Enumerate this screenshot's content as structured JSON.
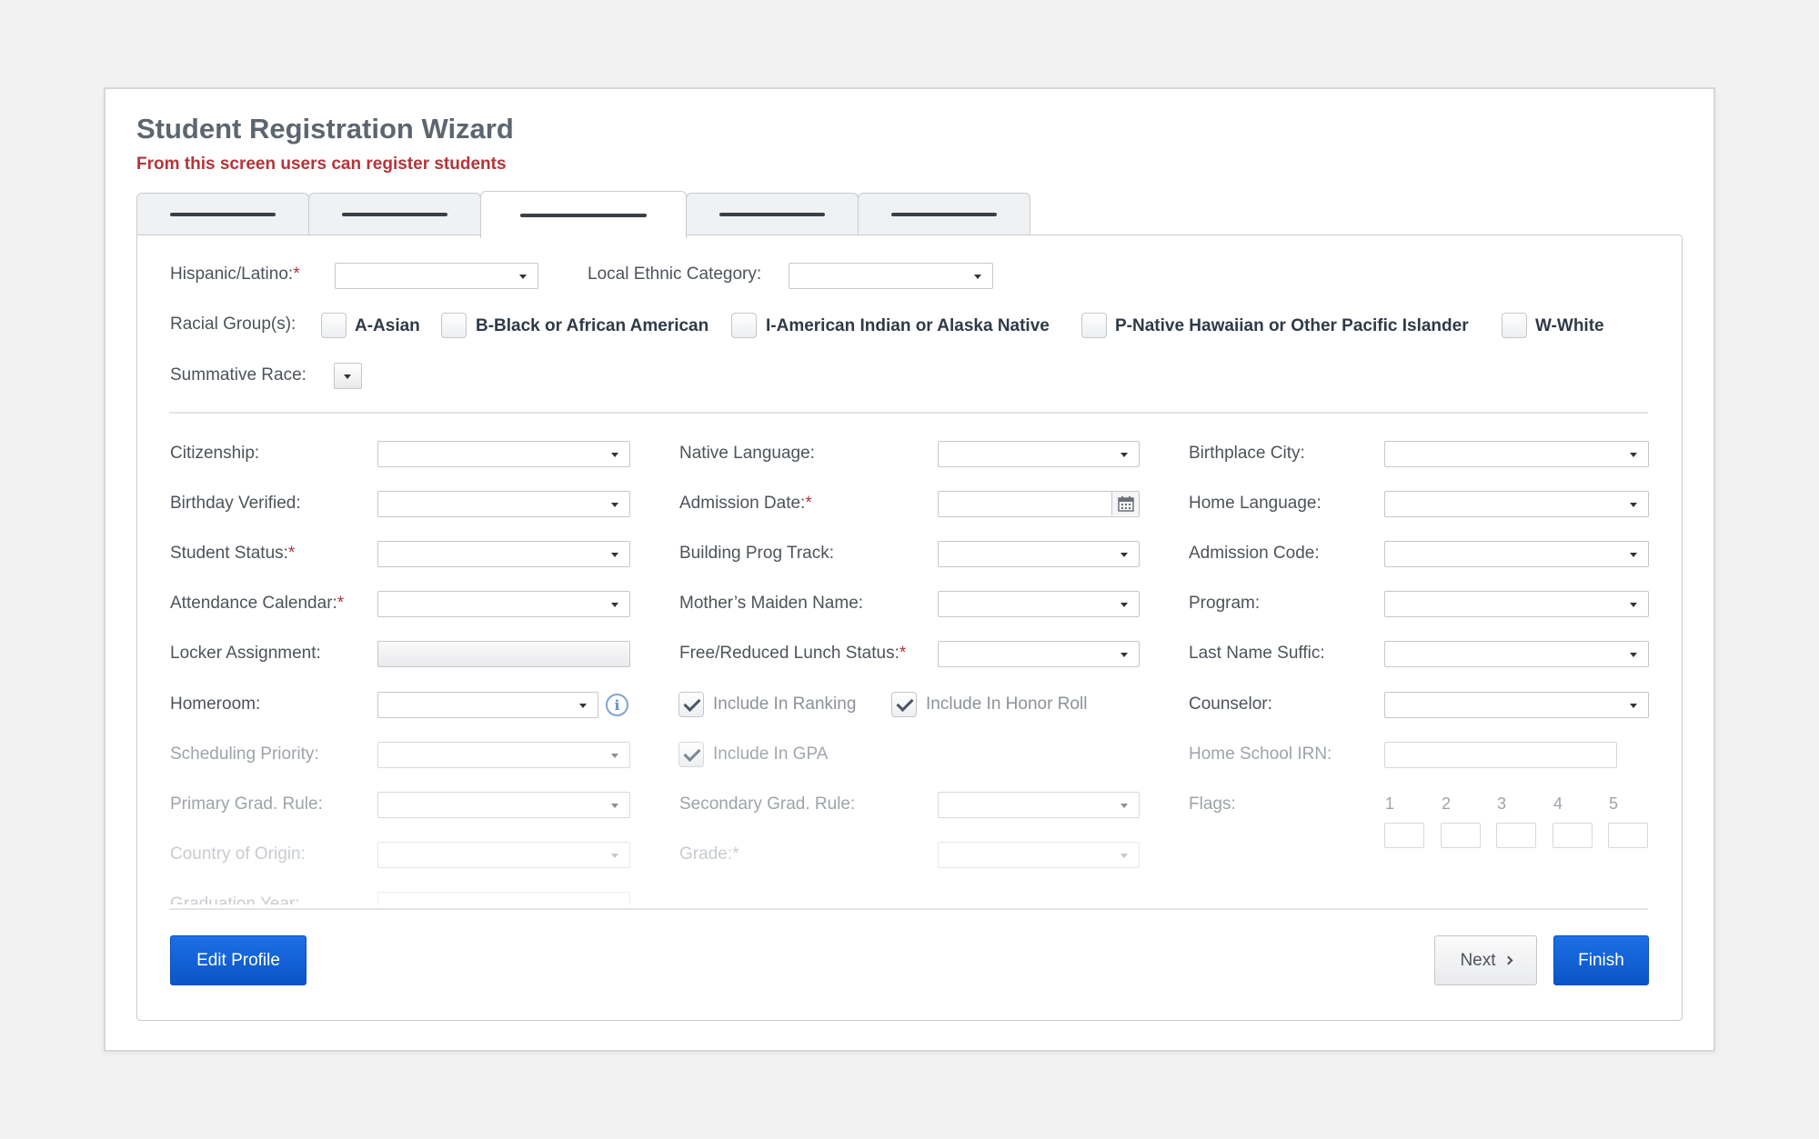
{
  "header": {
    "title": "Student Registration Wizard",
    "subtitle": "From this screen users can register students"
  },
  "tabs": [
    {
      "label": "",
      "active": false
    },
    {
      "label": "",
      "active": false
    },
    {
      "label": "",
      "active": true
    },
    {
      "label": "",
      "active": false
    },
    {
      "label": "",
      "active": false
    }
  ],
  "ethnicity": {
    "hispanic_label": "Hispanic/Latino:",
    "local_ethnic_label": "Local Ethnic Category:",
    "racial_groups_label": "Racial Group(s):",
    "racial_options": [
      {
        "label": "A-Asian",
        "checked": false
      },
      {
        "label": "B-Black or African American",
        "checked": false
      },
      {
        "label": "I-American Indian or Alaska Native",
        "checked": false
      },
      {
        "label": "P-Native Hawaiian or Other Pacific Islander",
        "checked": false
      },
      {
        "label": "W-White",
        "checked": false
      }
    ],
    "summative_race_label": "Summative Race:"
  },
  "fields": {
    "citizenship": "Citizenship:",
    "birthday_verified": "Birthday Verified:",
    "student_status": "Student Status:",
    "attendance_calendar": "Attendance Calendar:",
    "locker_assignment": "Locker Assignment:",
    "homeroom": "Homeroom:",
    "scheduling_priority": "Scheduling Priority:",
    "primary_grad_rule": "Primary Grad. Rule:",
    "country_of_origin": "Country of Origin:",
    "graduation_year": "Graduation Year:",
    "native_language": "Native Language:",
    "admission_date": "Admission Date:",
    "building_prog_track": "Building Prog Track:",
    "mothers_maiden_name": "Mother’s Maiden Name:",
    "free_reduced_lunch": "Free/Reduced Lunch Status:",
    "secondary_grad_rule": "Secondary Grad. Rule:",
    "grade": "Grade:",
    "birthplace_city": "Birthplace City:",
    "home_language": "Home Language:",
    "admission_code": "Admission Code:",
    "program": "Program:",
    "last_name_suffic": "Last Name Suffic:",
    "counselor": "Counselor:",
    "home_school_irn": "Home School IRN:",
    "flags": "Flags:"
  },
  "required_mark": "*",
  "checkboxes": {
    "include_in_ranking": {
      "label": "Include In Ranking",
      "checked": true
    },
    "include_in_honor_roll": {
      "label": "Include In Honor Roll",
      "checked": true
    },
    "include_in_gpa": {
      "label": "Include In GPA",
      "checked": true
    }
  },
  "flag_numbers": [
    "1",
    "2",
    "3",
    "4",
    "5"
  ],
  "footer": {
    "edit_profile": "Edit Profile",
    "next": "Next",
    "finish": "Finish"
  },
  "icons": {
    "info": "info-icon",
    "calendar": "calendar-icon",
    "chevron_right": "chevron-right-icon",
    "dropdown": "caret-down-icon"
  },
  "colors": {
    "accent": "#0a5fd4",
    "required": "#b4343a",
    "subtitle": "#b4343a"
  }
}
